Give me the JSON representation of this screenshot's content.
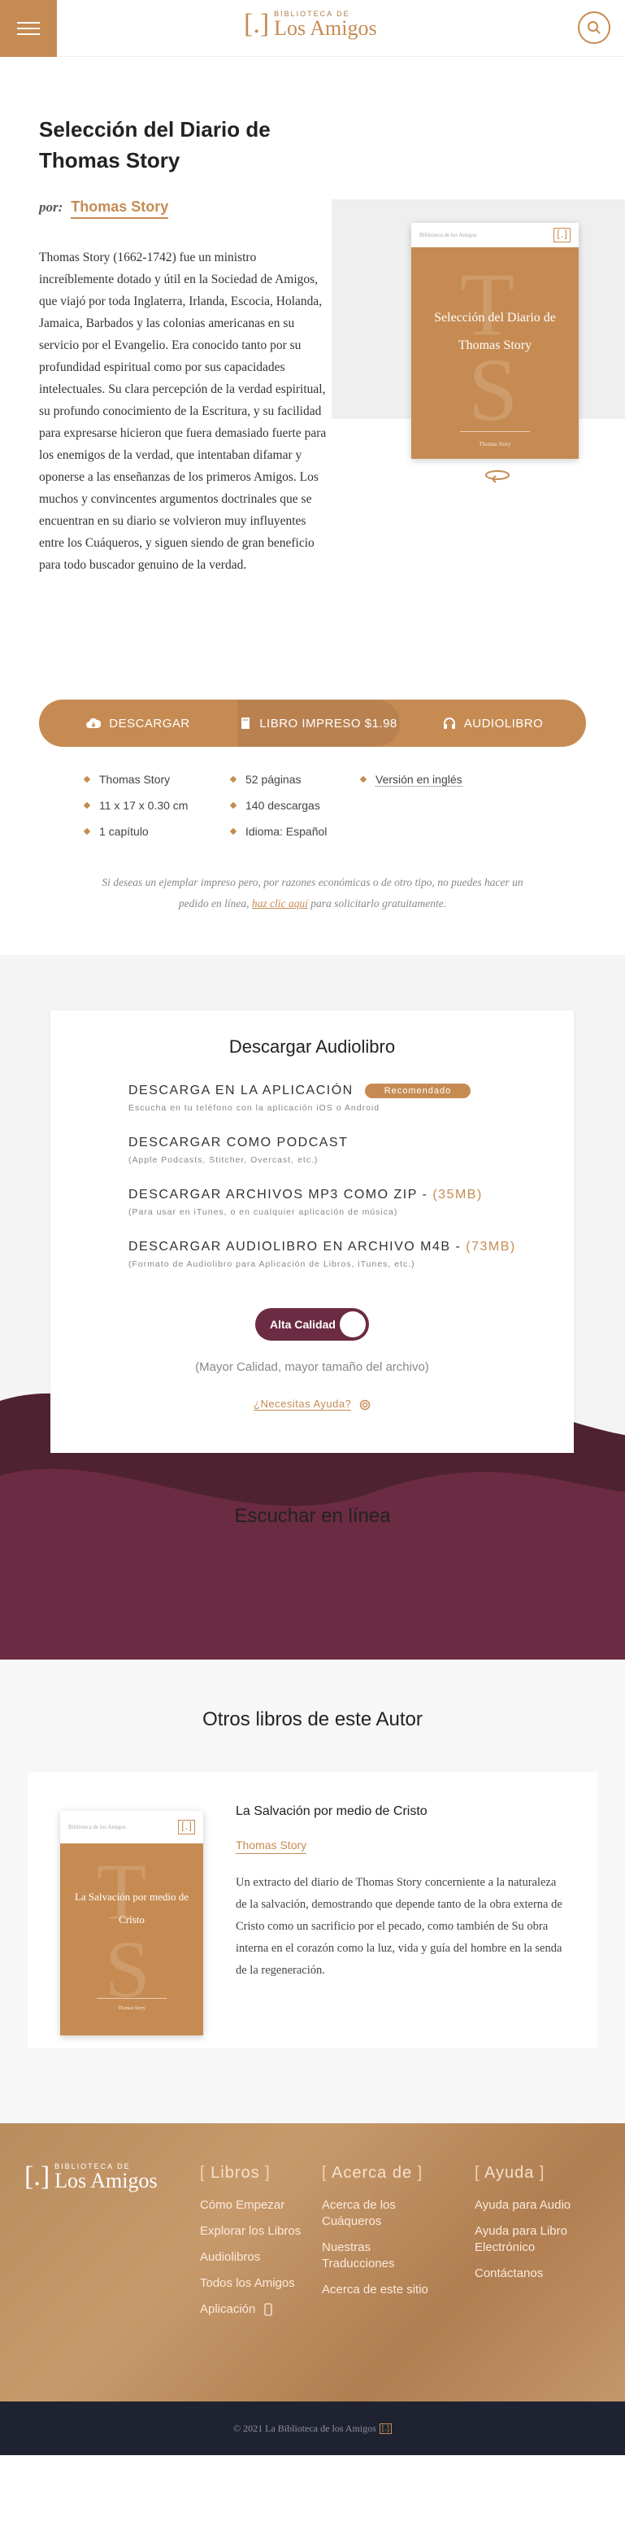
{
  "header": {
    "logo_small": "BIBLIOTECA DE",
    "logo_big": "Los Amigos",
    "logo_mark": "[.]"
  },
  "book": {
    "title": "Selección del Diario de Thomas Story",
    "por_label": "por:",
    "author": "Thomas Story",
    "description": "Thomas Story (1662-1742) fue un ministro increíblemente dotado y útil en la Sociedad de Amigos, que viajó por toda Inglaterra, Irlanda, Escocia, Holanda, Jamaica, Barbados y las colonias americanas en su servicio por el Evangelio. Era conocido tanto por su profundidad espiritual como por sus capacidades intelectuales. Su clara percepción de la verdad espiritual, su profundo conocimiento de la Escritura, y su facilidad para expresarse hicieron que fuera demasiado fuerte para los enemigos de la verdad, que intentaban difamar y oponerse a las enseñanzas de los primeros Amigos. Los muchos y convincentes argumentos doctrinales que se encuentran en su diario se volvieron muy influyentes entre los Cuáqueros, y siguen siendo de gran beneficio para todo buscador genuino de la verdad.",
    "cover": {
      "top_label": "Biblioteca de los Amigos",
      "title": "Selección del Diario de Thomas Story",
      "author": "Thomas Story",
      "bg_letters": [
        "T",
        "S"
      ]
    }
  },
  "actions": {
    "download": "DESCARGAR",
    "print": "LIBRO IMPRESO $1.98",
    "audio": "AUDIOLIBRO"
  },
  "meta": [
    "Thomas Story",
    "52 páginas",
    "Versión en inglés",
    "11 x 17 x 0.30 cm",
    "140 descargas",
    "1 capítulo",
    "Idioma: Español"
  ],
  "note": {
    "before": "Si deseas un ejemplar impreso pero, por razones económicas o de otro tipo, no puedes hacer un pedido en línea,",
    "link": "haz clic aquí",
    "after": "para solicitarlo gratuitamente."
  },
  "audiobook": {
    "title": "Descargar Audiolibro",
    "options": [
      {
        "title": "DESCARGA EN LA APLICACIÓN",
        "size": "",
        "sub": "Escucha en tu teléfono con la aplicación iOS o Android",
        "badge": "Recomendado"
      },
      {
        "title": "DESCARGAR COMO PODCAST",
        "size": "",
        "sub": "(Apple Podcasts, Stitcher, Overcast, etc.)",
        "badge": ""
      },
      {
        "title": "DESCARGAR ARCHIVOS MP3 COMO ZIP - ",
        "size": "(35MB)",
        "sub": "(Para usar en iTunes, o en cualquier aplicación de música)",
        "badge": ""
      },
      {
        "title": "DESCARGAR AUDIOLIBRO EN ARCHIVO M4B - ",
        "size": "(73MB)",
        "sub": "(Formato de Audiolibro para Aplicación de Libros, iTunes, etc.)",
        "badge": ""
      }
    ],
    "toggle_label": "Alta Calidad",
    "quality_note": "(Mayor Calidad, mayor tamaño del archivo)",
    "help": "¿Necesitas Ayuda?",
    "listen_title": "Escuchar en línea"
  },
  "others": {
    "title": "Otros libros de este Autor",
    "book": {
      "title": "La Salvación por medio de Cristo",
      "author": "Thomas Story",
      "description": "Un extracto del diario de Thomas Story concerniente a la naturaleza de la salvación, demostrando que depende tanto de la obra externa de Cristo como un sacrificio por el pecado, como también de Su obra interna en el corazón como la luz, vida y guía del hombre en la senda de la regeneración.",
      "cover": {
        "top_label": "Biblioteca de los Amigos",
        "title": "La Salvación por medio de Cristo",
        "author": "Thomas Story",
        "bg_letters": [
          "T",
          "S"
        ]
      }
    }
  },
  "footer": {
    "logo_small": "BIBLIOTECA DE",
    "logo_big": "Los Amigos",
    "columns": [
      {
        "title": "Libros",
        "items": [
          "Cómo Empezar",
          "Explorar los Libros",
          "Audiolibros",
          "Todos los Amigos",
          "Aplicación"
        ]
      },
      {
        "title": "Acerca de",
        "items": [
          "Acerca de los Cuáqueros",
          "Nuestras Traducciones",
          "Acerca de este sitio"
        ]
      },
      {
        "title": "Ayuda",
        "items": [
          "Ayuda para Audio",
          "Ayuda para Libro Electrónico",
          "Contáctanos"
        ]
      }
    ],
    "copyright": "© 2021 La Biblioteca de los Amigos",
    "copyright_mark": "[.]"
  },
  "colors": {
    "accent": "#c68b52",
    "maroon": "#6b2b42",
    "footer_bar": "#1f2331"
  }
}
